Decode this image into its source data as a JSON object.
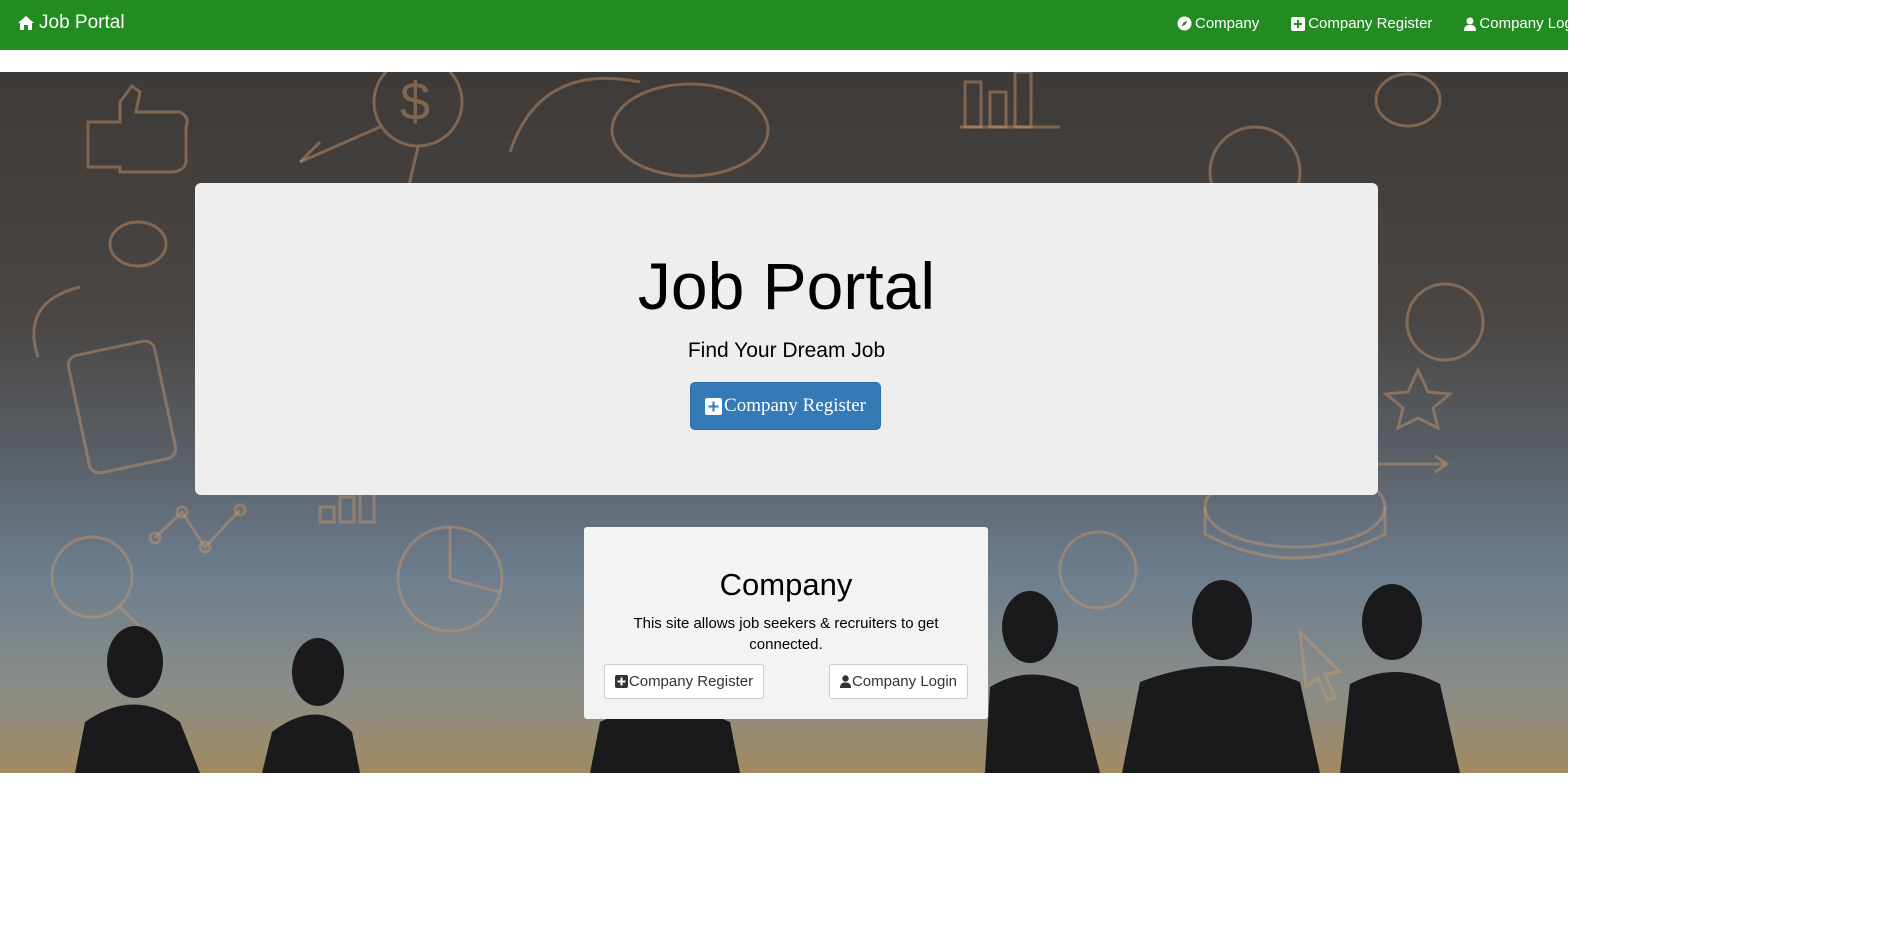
{
  "navbar": {
    "brand": "Job Portal",
    "brand_icon": "home-icon",
    "links": [
      {
        "label": "Company",
        "icon": "compass-icon"
      },
      {
        "label": "Company Register",
        "icon": "plus-square-icon"
      },
      {
        "label": "Company Login",
        "icon": "user-icon"
      }
    ],
    "background": "#228b22"
  },
  "hero": {
    "title": "Job Portal",
    "subtitle": "Find Your Dream Job",
    "button_label": "Company Register",
    "button_icon": "plus-square-icon",
    "button_color": "#337ab7"
  },
  "company_card": {
    "title": "Company",
    "description": "This site allows job seekers & recruiters to get connected.",
    "register_label": "Company Register",
    "login_label": "Company Login"
  }
}
